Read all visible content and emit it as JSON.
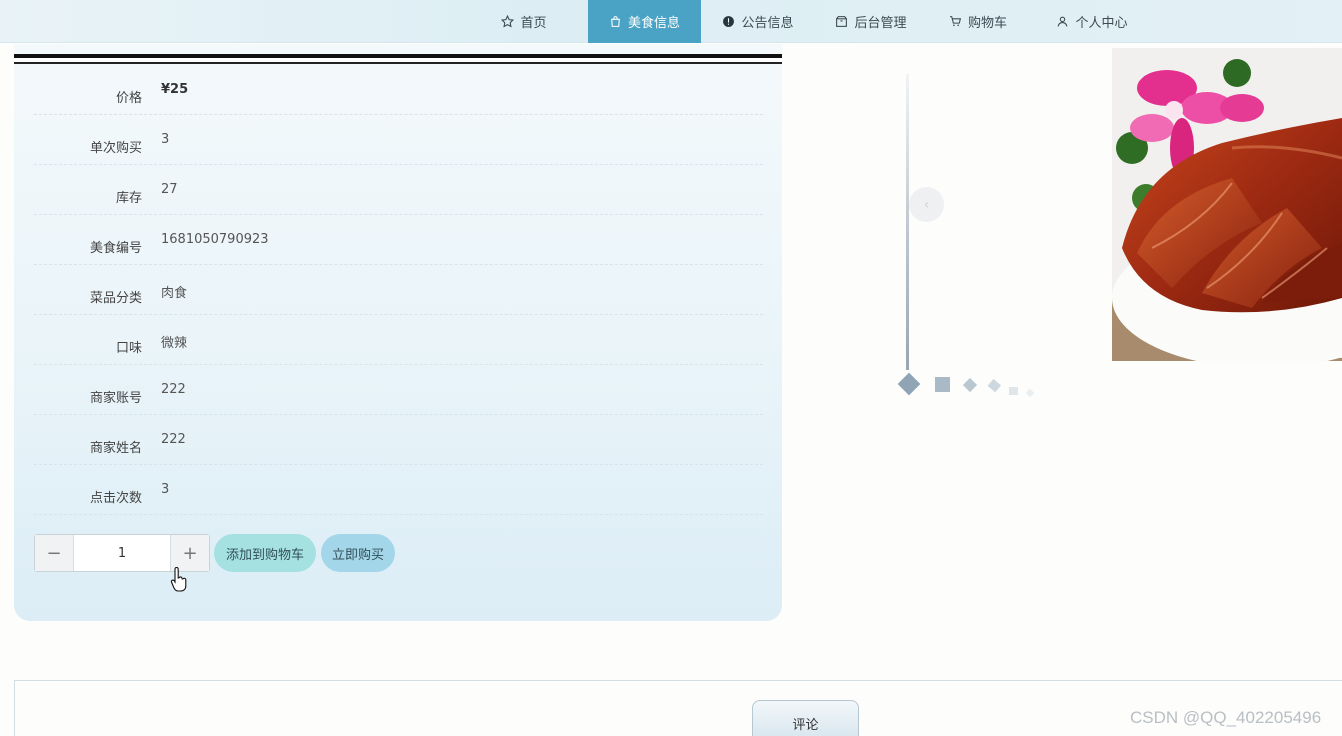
{
  "nav": {
    "items": [
      {
        "label": "首页",
        "icon": "star-icon"
      },
      {
        "label": "美食信息",
        "icon": "bag-icon",
        "active": true
      },
      {
        "label": "公告信息",
        "icon": "info-circle-icon"
      },
      {
        "label": "后台管理",
        "icon": "box-icon"
      },
      {
        "label": "购物车",
        "icon": "cart-icon"
      },
      {
        "label": "个人中心",
        "icon": "user-icon"
      }
    ],
    "active_color": "#4aa3c4"
  },
  "detail": {
    "rows": [
      {
        "label": "价格",
        "value": "¥25"
      },
      {
        "label": "单次购买",
        "value": "3"
      },
      {
        "label": "库存",
        "value": "27"
      },
      {
        "label": "美食编号",
        "value": "1681050790923"
      },
      {
        "label": "菜品分类",
        "value": "肉食"
      },
      {
        "label": "口味",
        "value": "微辣"
      },
      {
        "label": "商家账号",
        "value": "222"
      },
      {
        "label": "商家姓名",
        "value": "222"
      },
      {
        "label": "点击次数",
        "value": "3"
      }
    ],
    "quantity": "1",
    "minus_symbol": "−",
    "plus_symbol": "+",
    "add_to_cart_label": "添加到购物车",
    "buy_now_label": "立即购买"
  },
  "carousel": {
    "prev_symbol": "‹",
    "image": "roast-duck-photo",
    "dot_count": 6
  },
  "comments": {
    "tab_label": "评论"
  },
  "watermark": "CSDN @QQ_402205496"
}
